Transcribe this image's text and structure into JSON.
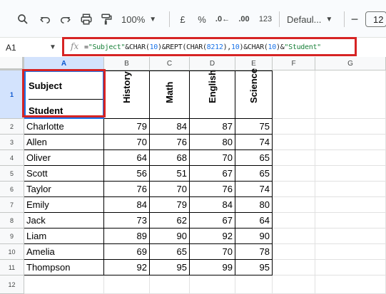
{
  "toolbar": {
    "zoom": "100%",
    "currency": "£",
    "percent": "%",
    "decrease_decimals": ".0←",
    "increase_decimals": ".00",
    "number_format": "123",
    "font": "Defaul...",
    "font_size": "12"
  },
  "formula_bar": {
    "name_box": "A1",
    "fx": "fx",
    "formula_parts": [
      "=",
      "\"Subject\"",
      "&CHAR(",
      "10",
      ")&REPT(CHAR(",
      "8212",
      "),",
      "10",
      ")&CHAR(",
      "10",
      ")&",
      "\"Student\""
    ]
  },
  "columns": [
    "A",
    "B",
    "C",
    "D",
    "E",
    "F",
    "G"
  ],
  "row_numbers": [
    "1",
    "2",
    "3",
    "4",
    "5",
    "6",
    "7",
    "8",
    "9",
    "10",
    "11",
    "12"
  ],
  "header_cell": {
    "top": "Subject",
    "bottom": "Student"
  },
  "subjects": [
    "History",
    "Math",
    "English",
    "Science"
  ],
  "rows": [
    {
      "name": "Charlotte",
      "history": 79,
      "math": 84,
      "english": 87,
      "science": 75
    },
    {
      "name": "Allen",
      "history": 70,
      "math": 76,
      "english": 80,
      "science": 74
    },
    {
      "name": "Oliver",
      "history": 64,
      "math": 68,
      "english": 70,
      "science": 65
    },
    {
      "name": "Scott",
      "history": 56,
      "math": 51,
      "english": 67,
      "science": 65
    },
    {
      "name": "Taylor",
      "history": 76,
      "math": 70,
      "english": 76,
      "science": 74
    },
    {
      "name": "Emily",
      "history": 84,
      "math": 79,
      "english": 84,
      "science": 80
    },
    {
      "name": "Jack",
      "history": 73,
      "math": 62,
      "english": 67,
      "science": 64
    },
    {
      "name": "Liam",
      "history": 89,
      "math": 90,
      "english": 92,
      "science": 90
    },
    {
      "name": "Amelia",
      "history": 69,
      "math": 65,
      "english": 70,
      "science": 78
    },
    {
      "name": "Thompson",
      "history": 92,
      "math": 95,
      "english": 99,
      "science": 95
    }
  ],
  "colors": {
    "highlight_red": "#d62424",
    "selection_blue": "#1a73e8",
    "string_green": "#188038",
    "number_blue": "#1a73e8"
  }
}
